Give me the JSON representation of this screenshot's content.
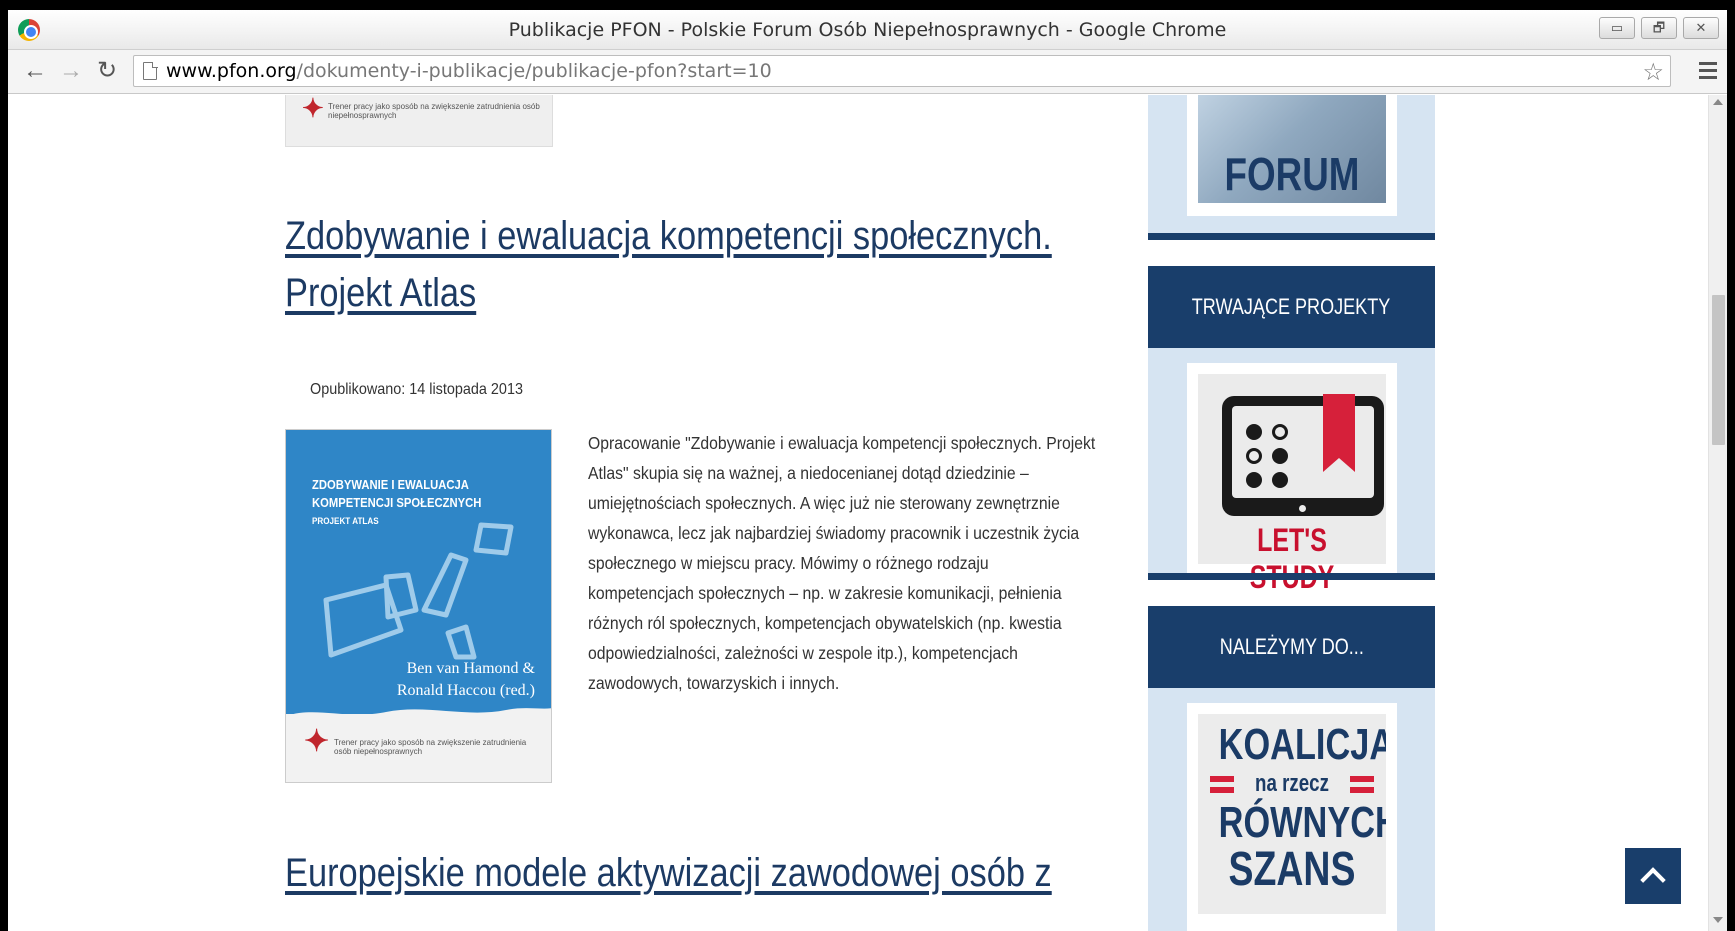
{
  "window": {
    "title": "Publikacje PFON - Polskie Forum Osób Niepełnosprawnych - Google Chrome",
    "buttons": [
      "▭",
      "🗗",
      "✕"
    ]
  },
  "toolbar": {
    "back_icon": "back-arrow-icon",
    "forward_icon": "forward-arrow-icon",
    "reload_icon": "reload-icon",
    "url_host": "www.pfon.org",
    "url_path": "/dokumenty-i-publikacje/publikacje-pfon?start=10",
    "star_icon": "bookmark-star-icon",
    "menu_icon": "hamburger-menu-icon"
  },
  "logo": {
    "mark": "trener pracy",
    "tagline": "Trener pracy jako sposób na zwiększenie zatrudnienia osób niepełnosprawnych"
  },
  "article": {
    "title_line1": "Zdobywanie i ewaluacja kompetencji społecznych.",
    "title_line2": "Projekt Atlas",
    "published": "Opublikowano: 14 listopada 2013",
    "body": "Opracowanie \"Zdobywanie i ewaluacja kompetencji społecznych. Projekt Atlas\" skupia się na ważnej, a niedocenianej dotąd dziedzinie – umiejętnościach społecznych. A więc już nie sterowany zewnętrznie wykonawca, lecz jak najbardziej świadomy pracownik i uczestnik życia społecznego w miejscu pracy. Mówimy o różnego rodzaju kompetencjach społecznych – np. w zakresie komunikacji, pełnienia różnych ról społecznych, kompetencjach obywatelskich (np. kwestia odpowiedzialności, zależności w zespole itp.), kompetencjach zawodowych, towarzyskich i innych."
  },
  "cover": {
    "title_line1": "ZDOBYWANIE I EWALUACJA",
    "title_line2": "KOMPETENCJI SPOŁECZNYCH",
    "subtitle": "PROJEKT ATLAS",
    "author1": "Ben van Hamond &",
    "author2": "Ronald Haccou (red.)"
  },
  "next_article": {
    "title": "Europejskie modele aktywizacji zawodowej osób z"
  },
  "sidebar": {
    "forum_label": "FORUM",
    "projects_heading": "TRWAJĄCE PROJEKTY",
    "study_label": "LET'S STUDY",
    "member_heading": "NALEŻYMY DO...",
    "koalicja_line1": "KOALICJA",
    "koalicja_line2": "na rzecz",
    "koalicja_line3": "RÓWNYCH",
    "koalicja_line4": "SZANS"
  },
  "colors": {
    "navy": "#193e6b",
    "light_blue": "#d6e4f2",
    "cover_blue": "#2f86c7",
    "red": "#d6203a"
  }
}
